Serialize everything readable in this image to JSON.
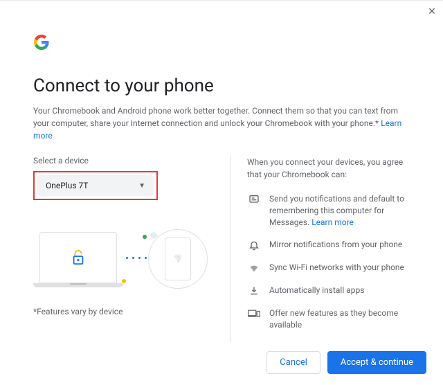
{
  "title": "Connect to your phone",
  "description": "Your Chromebook and Android phone work better together. Connect them so that you can text from your computer, share your Internet connection and unlock your Chromebook with your phone.* ",
  "learn_more": "Learn more",
  "left": {
    "select_label": "Select a device",
    "selected_device": "OnePlus 7T",
    "footnote": "*Features vary by device"
  },
  "right": {
    "agree_text": "When you connect your devices, you agree that your Chromebook can:",
    "features": [
      {
        "text": "Send you notifications and default to remembering this computer for Messages. ",
        "link": "Learn more"
      },
      {
        "text": "Mirror notifications from your phone"
      },
      {
        "text": "Sync Wi-Fi networks with your phone"
      },
      {
        "text": "Automatically install apps"
      },
      {
        "text": "Offer new features as they become available"
      }
    ]
  },
  "buttons": {
    "cancel": "Cancel",
    "accept": "Accept & continue"
  }
}
